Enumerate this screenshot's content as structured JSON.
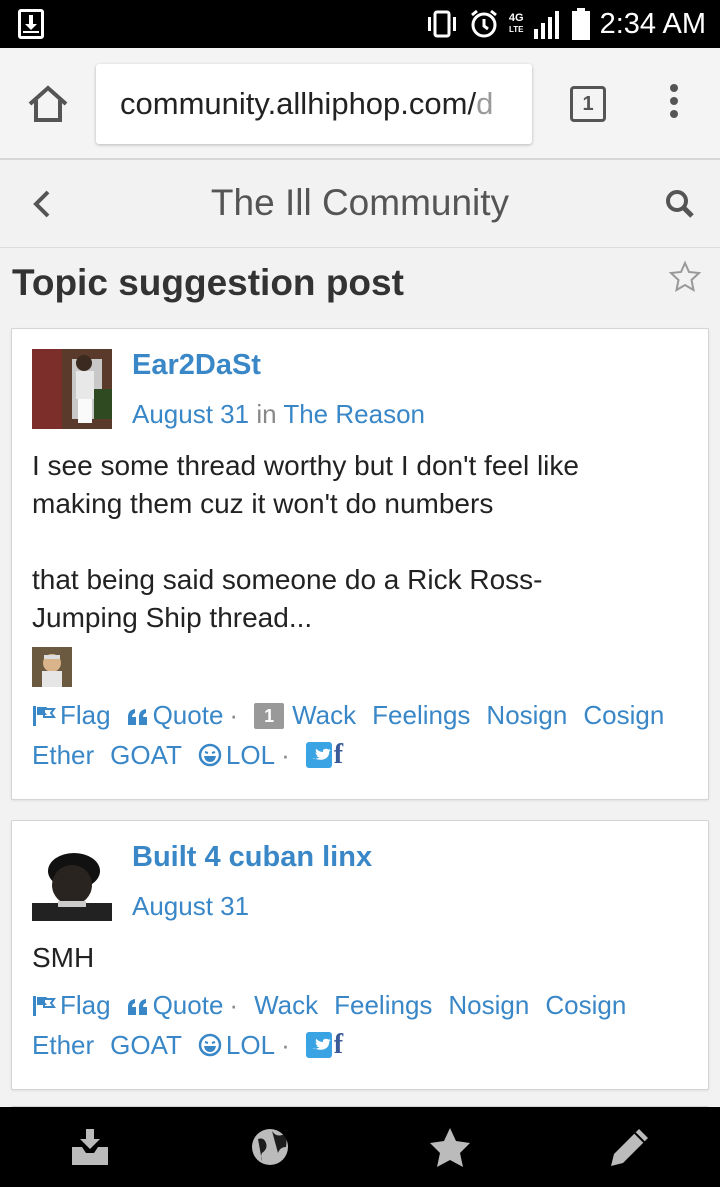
{
  "status_bar": {
    "time": "2:34 AM",
    "network": "4G",
    "network_sub": "LTE"
  },
  "browser": {
    "url_host": "community.allhiphop.com/",
    "url_path": "d",
    "tab_count": "1"
  },
  "site": {
    "title": "The Ill Community"
  },
  "topic": {
    "title": "Topic suggestion post"
  },
  "comments": [
    {
      "author": "Ear2DaSt",
      "date": "August 31",
      "in_word": "in",
      "category": "The Reason",
      "body_line1": "I see some thread worthy but I don't feel like making them cuz it won't do numbers",
      "body_line2": "that being said someone do a Rick Ross-Jumping Ship thread...",
      "reactions": {
        "flag": "Flag",
        "quote": "Quote",
        "wack_count": "1",
        "wack": "Wack",
        "feelings": "Feelings",
        "nosign": "Nosign",
        "cosign": "Cosign",
        "ether": "Ether",
        "goat": "GOAT",
        "lol": "LOL"
      }
    },
    {
      "author": "Built 4 cuban linx",
      "date": "August 31",
      "body_line1": "SMH",
      "reactions": {
        "flag": "Flag",
        "quote": "Quote",
        "wack": "Wack",
        "feelings": "Feelings",
        "nosign": "Nosign",
        "cosign": "Cosign",
        "ether": "Ether",
        "goat": "GOAT",
        "lol": "LOL"
      }
    }
  ],
  "colors": {
    "link": "#3a87c7",
    "twitter": "#3aa3e3",
    "facebook": "#3a5a98"
  },
  "bottom_nav": [
    "inbox-icon",
    "globe-icon",
    "star-icon",
    "pencil-icon"
  ]
}
